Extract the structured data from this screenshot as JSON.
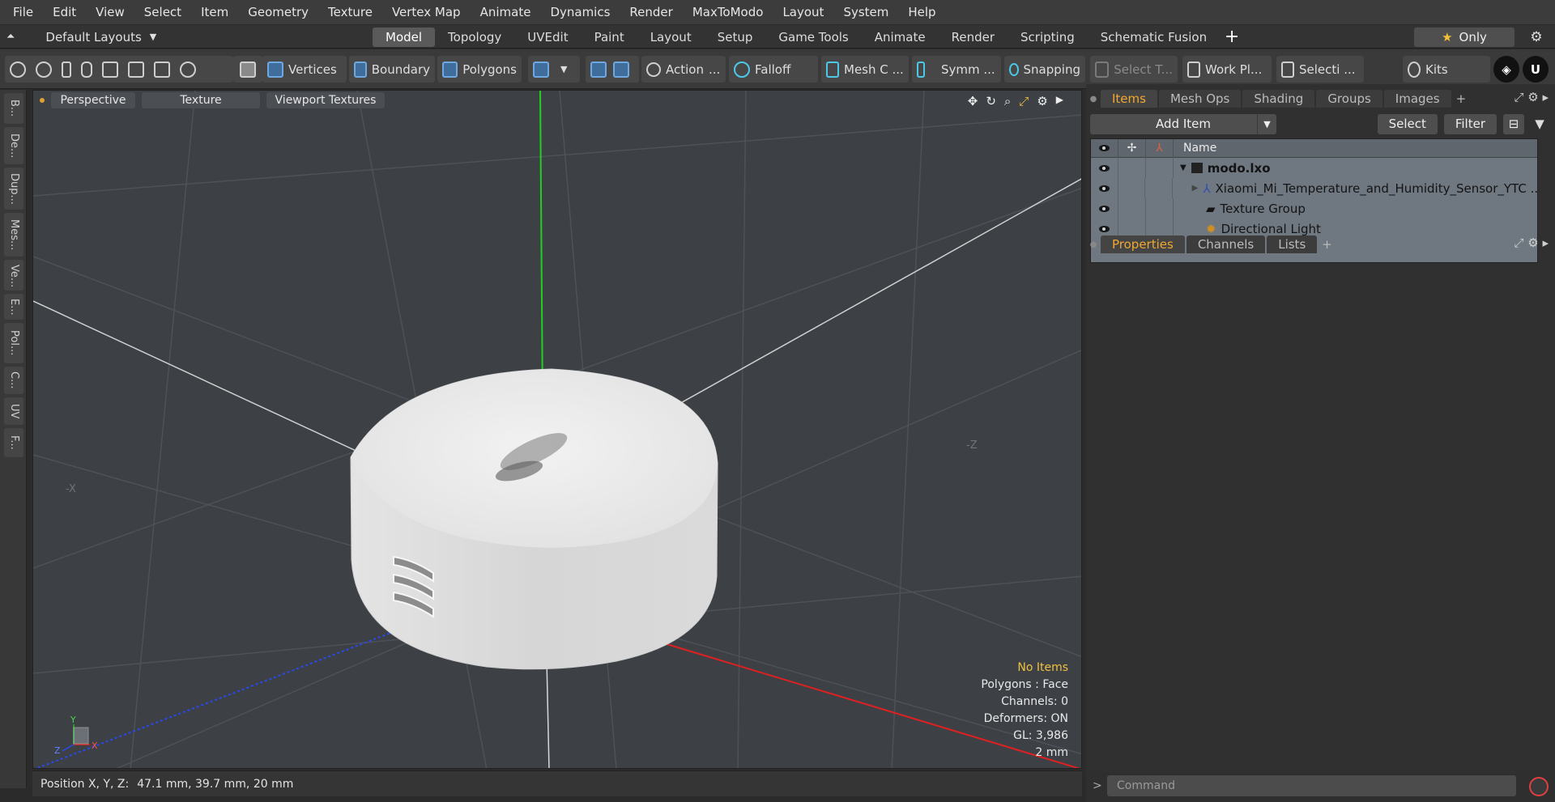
{
  "menubar": [
    "File",
    "Edit",
    "View",
    "Select",
    "Item",
    "Geometry",
    "Texture",
    "Vertex Map",
    "Animate",
    "Dynamics",
    "Render",
    "MaxToModo",
    "Layout",
    "System",
    "Help"
  ],
  "layoutbar": {
    "layout_selector": "Default Layouts",
    "tabs": [
      "Model",
      "Topology",
      "UVEdit",
      "Paint",
      "Layout",
      "Setup",
      "Game Tools",
      "Animate",
      "Render",
      "Scripting",
      "Schematic Fusion"
    ],
    "active_tab": "Model",
    "only_label": "Only"
  },
  "toolbar": {
    "vertices": "Vertices",
    "boundary": "Boundary",
    "polygons": "Polygons",
    "action": "Action",
    "falloff": "Falloff",
    "mesh": "Mesh C ...",
    "symmetry": "Symm ...",
    "snapping": "Snapping",
    "select_t": "Select T...",
    "workplane": "Work Pl...",
    "selection": "Selecti ...",
    "kits": "Kits"
  },
  "left_tabs": [
    "B...",
    "De...",
    "Dup...",
    "Mes...",
    "Ve...",
    "E...",
    "Pol...",
    "C...",
    "UV",
    "F..."
  ],
  "viewport": {
    "view": "Perspective",
    "shading": "Texture",
    "textures": "Viewport Textures",
    "info": {
      "no_items": "No Items",
      "polygons": "Polygons : Face",
      "channels": "Channels: 0",
      "deformers": "Deformers: ON",
      "gl": "GL: 3,986",
      "unit": "2 mm"
    },
    "axis_labels": {
      "neg_x": "-X",
      "neg_z": "-Z"
    },
    "gizmo": {
      "x": "X",
      "y": "Y",
      "z": "Z"
    }
  },
  "statusbar": {
    "position_label": "Position X, Y, Z:",
    "position_value": "47.1 mm, 39.7 mm, 20 mm"
  },
  "items_panel": {
    "tabs": [
      "Items",
      "Mesh Ops",
      "Shading",
      "Groups",
      "Images"
    ],
    "active_tab": "Items",
    "add_item": "Add Item",
    "select": "Select",
    "filter": "Filter",
    "name_header": "Name",
    "rows": [
      {
        "name": "modo.lxo",
        "bold": true
      },
      {
        "name": "Xiaomi_Mi_Temperature_and_Humidity_Sensor_YTC ..."
      },
      {
        "name": "Texture Group"
      },
      {
        "name": "Directional Light"
      }
    ]
  },
  "properties_panel": {
    "tabs": [
      "Properties",
      "Channels",
      "Lists"
    ],
    "active_tab": "Properties"
  },
  "command": {
    "placeholder": "Command",
    "prompt": ">"
  },
  "colors": {
    "accent": "#f0a830",
    "viewport_bg": "#3d4146",
    "x_axis": "#e02020",
    "y_axis": "#20c020",
    "z_axis": "#2040e0"
  }
}
